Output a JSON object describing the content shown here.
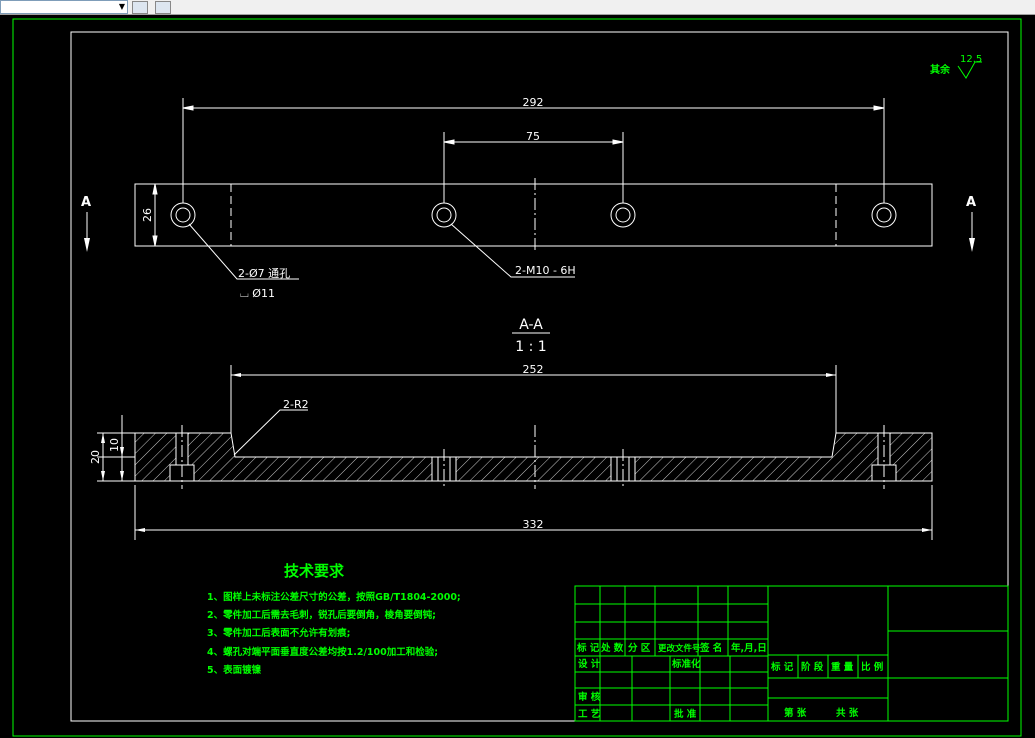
{
  "colors": {
    "background": "#000000",
    "frame_green": "#00ff00",
    "line_white": "#ffffff",
    "text_white": "#ffffff",
    "text_green": "#00ff00"
  },
  "toolbar": {
    "layer_combo_value": "",
    "icons": [
      "layers-icon",
      "layer-properties-icon"
    ]
  },
  "drawing": {
    "surface_finish": {
      "label": "其余",
      "value": "12.5"
    },
    "section_marker_left": "A",
    "section_marker_right": "A",
    "section_title": "A-A",
    "section_scale": "1 : 1",
    "dimensions": {
      "overall_top": "292",
      "hole_spacing": "75",
      "height_top": "26",
      "inner_length": "252",
      "overall_length": "332",
      "height_total": "20",
      "height_step": "10"
    },
    "callouts": {
      "through_hole": "2-Ø7 通孔",
      "counterbore": "⌴ Ø11",
      "thread": "2-M10 - 6H",
      "radius": "2-R2"
    },
    "tech_requirements": {
      "title": "技术要求",
      "items": [
        "1、图样上未标注公差尺寸的公差，按照GB/T1804-2000;",
        "2、零件加工后需去毛刺，锐孔后要倒角，棱角要倒钝;",
        "3、零件加工后表面不允许有划痕;",
        "4、螺孔对端平面垂直度公差均按1.2/100加工和检验;",
        "5、表面镀镍"
      ]
    },
    "title_block": {
      "header_row": [
        "标 记",
        "处 数",
        "分 区",
        "更改文件号",
        "签 名",
        "年,月,日"
      ],
      "design": "设 计",
      "standardize": "标准化",
      "review": "审 核",
      "process": "工 艺",
      "approve": "批 准",
      "stage_row": [
        "标 记",
        "阶 段",
        "重 量",
        "比 例"
      ],
      "sheet_row": [
        "第 张",
        "共 张"
      ]
    }
  }
}
